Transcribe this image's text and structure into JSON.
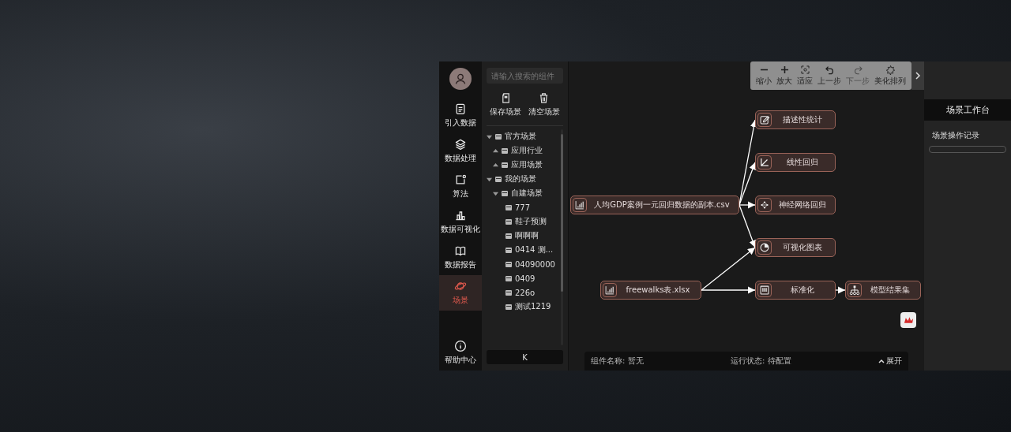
{
  "nav": {
    "items": [
      {
        "label": "引入数据",
        "selected": false
      },
      {
        "label": "数据处理",
        "selected": false
      },
      {
        "label": "算法",
        "selected": false
      },
      {
        "label": "数据可视化",
        "selected": false
      },
      {
        "label": "数据报告",
        "selected": false
      },
      {
        "label": "场景",
        "selected": true
      }
    ],
    "help": "帮助中心"
  },
  "scene_panel": {
    "search": {
      "placeholder": "请输入搜索的组件"
    },
    "actions": [
      "保存场景",
      "清空场景"
    ],
    "tree": [
      {
        "label": "官方场景",
        "expanded": true,
        "children": [
          {
            "label": "应用行业",
            "expanded": false
          },
          {
            "label": "应用场景",
            "expanded": false
          }
        ]
      },
      {
        "label": "我的场景",
        "expanded": true,
        "children": [
          {
            "label": "自建场景",
            "expanded": true,
            "children": [
              {
                "label": "777"
              },
              {
                "label": "鞋子预测"
              },
              {
                "label": "啊啊啊"
              },
              {
                "label": "0414 测..."
              },
              {
                "label": "04090000"
              },
              {
                "label": "0409"
              },
              {
                "label": "226o"
              },
              {
                "label": "测试1219"
              }
            ]
          }
        ]
      }
    ],
    "collapse_button": "K"
  },
  "toolbar": [
    {
      "label": "缩小",
      "disabled": false
    },
    {
      "label": "放大",
      "disabled": false
    },
    {
      "label": "适应",
      "disabled": false
    },
    {
      "label": "上一步",
      "disabled": false
    },
    {
      "label": "下一步",
      "disabled": true
    },
    {
      "label": "美化排列",
      "disabled": false
    }
  ],
  "canvas": {
    "nodes": [
      {
        "label": "人均GDP案例一元回归数据的副本.csv"
      },
      {
        "label": "描述性统计"
      },
      {
        "label": "线性回归"
      },
      {
        "label": "神经网络回归"
      },
      {
        "label": "可视化图表"
      },
      {
        "label": "freewalks表.xlsx"
      },
      {
        "label": "标准化"
      },
      {
        "label": "模型结果集"
      }
    ]
  },
  "status_bar": {
    "component": "组件名称: 暂无",
    "run_state": "运行状态: 待配置",
    "expand": "展开"
  },
  "right_panel": {
    "title": "场景工作台",
    "section": "场景操作记录"
  }
}
